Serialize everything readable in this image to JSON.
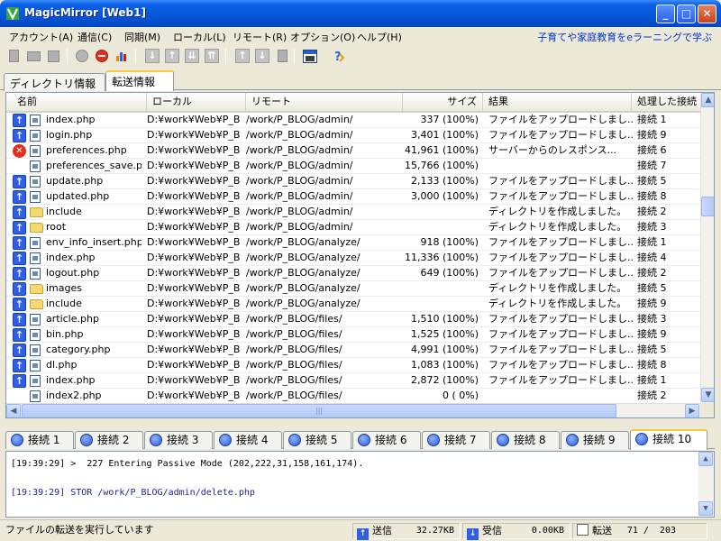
{
  "window": {
    "title": "MagicMirror [Web1]",
    "minimize": "_",
    "maximize": "□",
    "close": "✕"
  },
  "menu": {
    "items": [
      "アカウント(A)",
      "通信(C)",
      "同期(M)",
      "ローカル(L)",
      "リモート(R)",
      "オプション(O)",
      "ヘルプ(H)"
    ],
    "promo": "子育てや家庭教育をeラーニングで学ぶ"
  },
  "tabs": [
    "ディレクトリ情報",
    "転送情報"
  ],
  "columns": [
    "名前",
    "ローカル",
    "リモート",
    "サイズ",
    "結果",
    "処理した接続"
  ],
  "rows": [
    {
      "status": "up",
      "type": "file",
      "name": "index.php",
      "local": "D:¥work¥Web¥P_B...",
      "remote": "/work/P_BLOG/admin/",
      "size": "337 (100%)",
      "result": "ファイルをアップロードしまし...",
      "conn": "接続 1"
    },
    {
      "status": "up",
      "type": "file",
      "name": "login.php",
      "local": "D:¥work¥Web¥P_B...",
      "remote": "/work/P_BLOG/admin/",
      "size": "3,401 (100%)",
      "result": "ファイルをアップロードしまし...",
      "conn": "接続 9"
    },
    {
      "status": "error",
      "type": "file",
      "name": "preferences.php",
      "local": "D:¥work¥Web¥P_B...",
      "remote": "/work/P_BLOG/admin/",
      "size": "41,961 (100%)",
      "result": "サーバーからのレスポンス...",
      "conn": "接続 6"
    },
    {
      "status": "none",
      "type": "file",
      "name": "preferences_save.p...",
      "local": "D:¥work¥Web¥P_B...",
      "remote": "/work/P_BLOG/admin/",
      "size": "15,766 (100%)",
      "result": "",
      "conn": "接続 7"
    },
    {
      "status": "up",
      "type": "file",
      "name": "update.php",
      "local": "D:¥work¥Web¥P_B...",
      "remote": "/work/P_BLOG/admin/",
      "size": "2,133 (100%)",
      "result": "ファイルをアップロードしまし...",
      "conn": "接続 5"
    },
    {
      "status": "up",
      "type": "file",
      "name": "updated.php",
      "local": "D:¥work¥Web¥P_B...",
      "remote": "/work/P_BLOG/admin/",
      "size": "3,000 (100%)",
      "result": "ファイルをアップロードしまし...",
      "conn": "接続 8"
    },
    {
      "status": "up",
      "type": "folder",
      "name": "include",
      "local": "D:¥work¥Web¥P_B...",
      "remote": "/work/P_BLOG/admin/",
      "size": "",
      "result": "ディレクトリを作成しました。",
      "conn": "接続 2"
    },
    {
      "status": "up",
      "type": "folder",
      "name": "root",
      "local": "D:¥work¥Web¥P_B...",
      "remote": "/work/P_BLOG/admin/",
      "size": "",
      "result": "ディレクトリを作成しました。",
      "conn": "接続 3"
    },
    {
      "status": "up",
      "type": "file",
      "name": "env_info_insert.php",
      "local": "D:¥work¥Web¥P_B...",
      "remote": "/work/P_BLOG/analyze/",
      "size": "918 (100%)",
      "result": "ファイルをアップロードしまし...",
      "conn": "接続 1"
    },
    {
      "status": "up",
      "type": "file",
      "name": "index.php",
      "local": "D:¥work¥Web¥P_B...",
      "remote": "/work/P_BLOG/analyze/",
      "size": "11,336 (100%)",
      "result": "ファイルをアップロードしまし...",
      "conn": "接続 4"
    },
    {
      "status": "up",
      "type": "file",
      "name": "logout.php",
      "local": "D:¥work¥Web¥P_B...",
      "remote": "/work/P_BLOG/analyze/",
      "size": "649 (100%)",
      "result": "ファイルをアップロードしまし...",
      "conn": "接続 2"
    },
    {
      "status": "up",
      "type": "folder",
      "name": "images",
      "local": "D:¥work¥Web¥P_B...",
      "remote": "/work/P_BLOG/analyze/",
      "size": "",
      "result": "ディレクトリを作成しました。",
      "conn": "接続 5"
    },
    {
      "status": "up",
      "type": "folder",
      "name": "include",
      "local": "D:¥work¥Web¥P_B...",
      "remote": "/work/P_BLOG/analyze/",
      "size": "",
      "result": "ディレクトリを作成しました。",
      "conn": "接続 9"
    },
    {
      "status": "up",
      "type": "file",
      "name": "article.php",
      "local": "D:¥work¥Web¥P_B...",
      "remote": "/work/P_BLOG/files/",
      "size": "1,510 (100%)",
      "result": "ファイルをアップロードしまし...",
      "conn": "接続 3"
    },
    {
      "status": "up",
      "type": "file",
      "name": "bin.php",
      "local": "D:¥work¥Web¥P_B...",
      "remote": "/work/P_BLOG/files/",
      "size": "1,525 (100%)",
      "result": "ファイルをアップロードしまし...",
      "conn": "接続 9"
    },
    {
      "status": "up",
      "type": "file",
      "name": "category.php",
      "local": "D:¥work¥Web¥P_B...",
      "remote": "/work/P_BLOG/files/",
      "size": "4,991 (100%)",
      "result": "ファイルをアップロードしまし...",
      "conn": "接続 5"
    },
    {
      "status": "up",
      "type": "file",
      "name": "dl.php",
      "local": "D:¥work¥Web¥P_B...",
      "remote": "/work/P_BLOG/files/",
      "size": "1,083 (100%)",
      "result": "ファイルをアップロードしまし...",
      "conn": "接続 8"
    },
    {
      "status": "up",
      "type": "file",
      "name": "index.php",
      "local": "D:¥work¥Web¥P_B...",
      "remote": "/work/P_BLOG/files/",
      "size": "2,872 (100%)",
      "result": "ファイルをアップロードしまし...",
      "conn": "接続 1"
    },
    {
      "status": "none",
      "type": "file",
      "name": "index2.php",
      "local": "D:¥work¥Web¥P_B...",
      "remote": "/work/P_BLOG/files/",
      "size": "0 ( 0%)",
      "result": "",
      "conn": "接続 2"
    }
  ],
  "connection_tabs": [
    "接続 1",
    "接続 2",
    "接続 3",
    "接続 4",
    "接続 5",
    "接続 6",
    "接続 7",
    "接続 8",
    "接続 9",
    "接続 10"
  ],
  "active_connection": "接続 10",
  "log": [
    "[19:39:29] >  227 Entering Passive Mode (202,222,31,158,161,174).",
    "[19:39:29] STOR /work/P_BLOG/admin/delete.php"
  ],
  "status": {
    "message": "ファイルの転送を実行しています",
    "send_label": "送信",
    "send_value": "32.27KB",
    "recv_label": "受信",
    "recv_value": "0.00KB",
    "transfer_label": "転送",
    "transfer_value": "71 /  203"
  },
  "colors": {
    "titlebar": "#0656d8",
    "accent_tab": "#ffc83c",
    "upload_icon": "#2f5fe6",
    "error_icon": "#e0301e",
    "promo_text": "#0033cc"
  }
}
